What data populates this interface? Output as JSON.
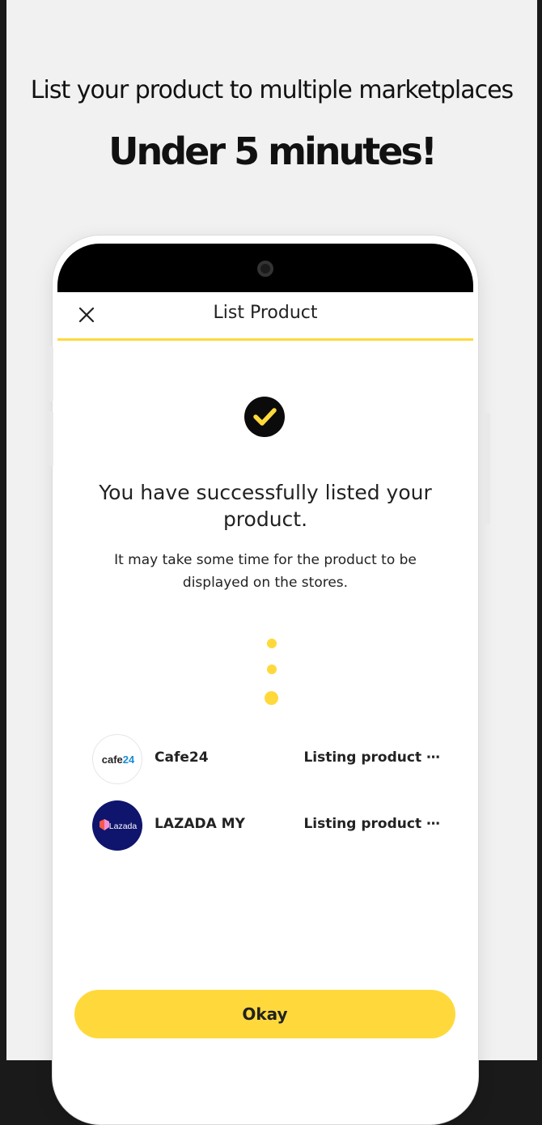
{
  "promo": {
    "headline": "List your product to multiple marketplaces",
    "subheadline": "Under 5 minutes!"
  },
  "app_bar": {
    "title": "List Product",
    "close_icon": "close-icon"
  },
  "result": {
    "icon": "check-circle-icon",
    "success_message": "You have successfully listed your product.",
    "info_message": "It may take some time for the product to be displayed on the stores."
  },
  "stores": [
    {
      "name": "Cafe24",
      "logo_text": "cafe24",
      "status": "Listing product ⋯"
    },
    {
      "name": "LAZADA MY",
      "logo_text": "Lazada",
      "status": "Listing product ⋯"
    }
  ],
  "actions": {
    "okay_label": "Okay"
  },
  "colors": {
    "accent": "#ffd93b",
    "background": "#f1f1f1",
    "phone_frame": "#000000",
    "lazada_badge": "#0f146d",
    "cafe24_blue": "#1a8cd8"
  }
}
